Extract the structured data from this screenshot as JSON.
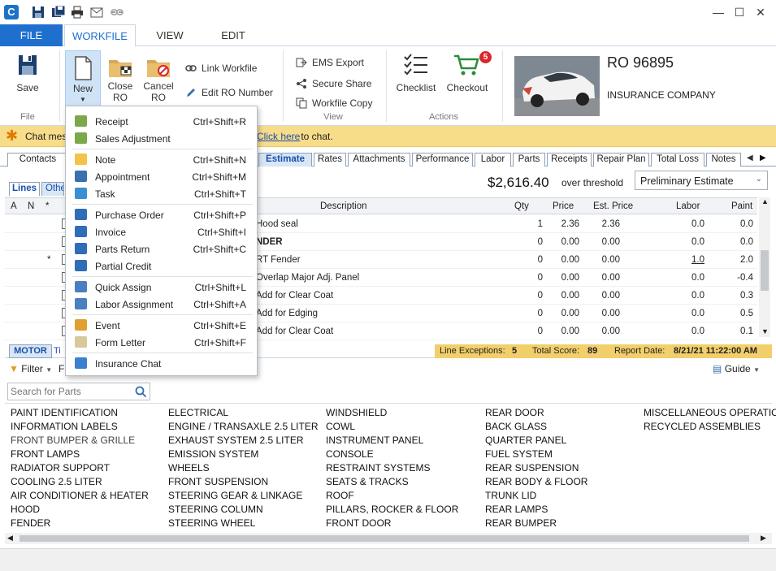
{
  "titlebar": {
    "app_icon": "C",
    "quick_access": [
      "save-icon",
      "save-all-icon",
      "print-icon",
      "email-icon",
      "link-icon"
    ],
    "window_buttons": {
      "minimize": "—",
      "maximize": "☐",
      "close": "✕"
    }
  },
  "ribbon_tabs": [
    "FILE",
    "WORKFILE",
    "VIEW",
    "EDIT"
  ],
  "ribbon": {
    "save": "Save",
    "new": "New",
    "close_ro": [
      "Close",
      "RO"
    ],
    "cancel_ro": [
      "Cancel",
      "RO"
    ],
    "link_workfile": "Link Workfile",
    "edit_ro_number": "Edit RO Number",
    "ems_export": "EMS Export",
    "secure_share": "Secure Share",
    "workfile_copy": "Workfile Copy",
    "checklist": "Checklist",
    "checkout": "Checkout",
    "checkout_badge": "5",
    "group_file": "File",
    "group_view": "View",
    "group_actions": "Actions",
    "ro_number": "RO 96895",
    "insurance": "INSURANCE COMPANY"
  },
  "chat": {
    "prefix": "Chat mes",
    "link": "Click here",
    "suffix": " to chat."
  },
  "tabs2": [
    "Contacts",
    "Estimate",
    "Rates",
    "Attachments",
    "Performance",
    "Labor",
    "Parts",
    "Receipts",
    "Repair Plan",
    "Total Loss",
    "Notes"
  ],
  "estimate": {
    "total": "$2,616.40",
    "threshold_label": "over threshold",
    "estimate_type": "Preliminary Estimate",
    "subtabs": [
      "Lines",
      "Othe"
    ],
    "columns": [
      "A",
      "N",
      "*",
      "Description",
      "Qty",
      "Price",
      "Est. Price",
      "Labor",
      "Paint"
    ],
    "rows": [
      {
        "mark": "",
        "desc": "Hood seal",
        "bold": false,
        "qty": "1",
        "price": "2.36",
        "est": "2.36",
        "labor": "0.0",
        "paint": "0.0"
      },
      {
        "mark": "",
        "desc": "NDER",
        "bold": true,
        "qty": "0",
        "price": "0.00",
        "est": "0.00",
        "labor": "0.0",
        "paint": "0.0"
      },
      {
        "mark": "*",
        "desc": "RT Fender",
        "bold": false,
        "qty": "0",
        "price": "0.00",
        "est": "0.00",
        "labor": "1.0",
        "paint": "2.0"
      },
      {
        "mark": "",
        "desc": "Overlap Major Adj. Panel",
        "bold": false,
        "qty": "0",
        "price": "0.00",
        "est": "0.00",
        "labor": "0.0",
        "paint": "-0.4"
      },
      {
        "mark": "",
        "desc": "Add for Clear Coat",
        "bold": false,
        "qty": "0",
        "price": "0.00",
        "est": "0.00",
        "labor": "0.0",
        "paint": "0.3"
      },
      {
        "mark": "",
        "desc": "Add for Edging",
        "bold": false,
        "qty": "0",
        "price": "0.00",
        "est": "0.00",
        "labor": "0.0",
        "paint": "0.5"
      },
      {
        "mark": "",
        "desc": "Add for Clear Coat",
        "bold": false,
        "qty": "0",
        "price": "0.00",
        "est": "0.00",
        "labor": "0.0",
        "paint": "0.1"
      }
    ],
    "status": {
      "line_exceptions_label": "Line Exceptions:",
      "line_exceptions": "5",
      "total_score_label": "Total Score:",
      "total_score": "89",
      "report_date_label": "Report Date:",
      "report_date": "8/21/21 11:22:00 AM"
    }
  },
  "lower": {
    "tabs": [
      "MOTOR",
      "Ti"
    ],
    "filter": "Filter",
    "filter2": "F",
    "guide": "Guide",
    "search_placeholder": "Search for Parts",
    "parts_columns": [
      [
        "PAINT IDENTIFICATION",
        "INFORMATION LABELS",
        "FRONT BUMPER & GRILLE",
        "FRONT LAMPS",
        "RADIATOR SUPPORT",
        "COOLING 2.5 LITER",
        "AIR CONDITIONER & HEATER",
        "HOOD",
        "FENDER"
      ],
      [
        "ELECTRICAL",
        "ENGINE / TRANSAXLE 2.5 LITER",
        "EXHAUST SYSTEM 2.5 LITER",
        "EMISSION SYSTEM",
        "WHEELS",
        "FRONT SUSPENSION",
        "STEERING GEAR & LINKAGE",
        "STEERING COLUMN",
        "STEERING WHEEL"
      ],
      [
        "WINDSHIELD",
        "COWL",
        "INSTRUMENT PANEL",
        "CONSOLE",
        "RESTRAINT SYSTEMS",
        "SEATS & TRACKS",
        "ROOF",
        "PILLARS, ROCKER & FLOOR",
        "FRONT DOOR"
      ],
      [
        "REAR DOOR",
        "BACK GLASS",
        "QUARTER PANEL",
        "FUEL SYSTEM",
        "REAR SUSPENSION",
        "REAR BODY & FLOOR",
        "TRUNK LID",
        "REAR LAMPS",
        "REAR BUMPER"
      ],
      [
        "MISCELLANEOUS OPERATION",
        "RECYCLED ASSEMBLIES"
      ]
    ]
  },
  "menu": {
    "groups": [
      [
        {
          "label": "Receipt",
          "shortcut": "Ctrl+Shift+R",
          "icon": "receipt-icon",
          "color": "#7aa84a"
        },
        {
          "label": "Sales Adjustment",
          "shortcut": "",
          "icon": "sales-adjustment-icon",
          "color": "#7aa84a"
        }
      ],
      [
        {
          "label": "Note",
          "shortcut": "Ctrl+Shift+N",
          "icon": "note-icon",
          "color": "#f2c24a"
        },
        {
          "label": "Appointment",
          "shortcut": "Ctrl+Shift+M",
          "icon": "appointment-icon",
          "color": "#3a6fb0"
        },
        {
          "label": "Task",
          "shortcut": "Ctrl+Shift+T",
          "icon": "task-icon",
          "color": "#3a8fd0"
        }
      ],
      [
        {
          "label": "Purchase Order",
          "shortcut": "Ctrl+Shift+P",
          "icon": "purchase-order-icon",
          "color": "#2f6db5"
        },
        {
          "label": "Invoice",
          "shortcut": "Ctrl+Shift+I",
          "icon": "invoice-icon",
          "color": "#2f6db5"
        },
        {
          "label": "Parts Return",
          "shortcut": "Ctrl+Shift+C",
          "icon": "parts-return-icon",
          "color": "#2f6db5"
        },
        {
          "label": "Partial Credit",
          "shortcut": "",
          "icon": "partial-credit-icon",
          "color": "#2f6db5"
        }
      ],
      [
        {
          "label": "Quick Assign",
          "shortcut": "Ctrl+Shift+L",
          "icon": "quick-assign-icon",
          "color": "#4a7fc0"
        },
        {
          "label": "Labor Assignment",
          "shortcut": "Ctrl+Shift+A",
          "icon": "labor-assignment-icon",
          "color": "#4a7fc0"
        }
      ],
      [
        {
          "label": "Event",
          "shortcut": "Ctrl+Shift+E",
          "icon": "event-icon",
          "color": "#e0a030"
        },
        {
          "label": "Form Letter",
          "shortcut": "Ctrl+Shift+F",
          "icon": "form-letter-icon",
          "color": "#d8c89a"
        }
      ],
      [
        {
          "label": "Insurance Chat",
          "shortcut": "",
          "icon": "insurance-chat-icon",
          "color": "#3a7fd0"
        }
      ]
    ]
  },
  "colors": {
    "accent": "#1f6fcf",
    "chat_bar": "#f7dc8a",
    "status_bar": "#f2cf6a",
    "badge": "#d9262c"
  }
}
